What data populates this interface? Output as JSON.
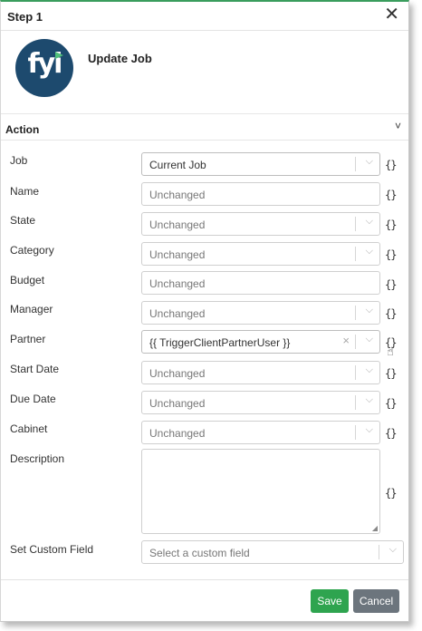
{
  "dialog": {
    "title": "Step 1",
    "close_glyph": "✕"
  },
  "app": {
    "logo_text": "fyi",
    "action_title": "Update Job"
  },
  "section": {
    "label": "Action",
    "caret": "˅"
  },
  "rows": [
    {
      "label": "Job",
      "value": "Current Job",
      "type": "select"
    },
    {
      "label": "Name",
      "placeholder": "Unchanged",
      "type": "input"
    },
    {
      "label": "State",
      "value": "Unchanged",
      "type": "select"
    },
    {
      "label": "Category",
      "value": "Unchanged",
      "type": "select"
    },
    {
      "label": "Budget",
      "placeholder": "Unchanged",
      "type": "input"
    },
    {
      "label": "Manager",
      "value": "Unchanged",
      "type": "select"
    },
    {
      "label": "Partner",
      "value": "{{ TriggerClientPartnerUser }}",
      "type": "select"
    },
    {
      "label": "Start Date",
      "value": "Unchanged",
      "type": "select"
    },
    {
      "label": "Due Date",
      "value": "Unchanged",
      "type": "select"
    },
    {
      "label": "Cabinet",
      "value": "Unchanged",
      "type": "select"
    }
  ],
  "description": {
    "label": "Description",
    "value": ""
  },
  "custom_field": {
    "label": "Set Custom Field",
    "placeholder": "Select a custom field"
  },
  "icons": {
    "variable": "{}",
    "chevron": "⌵",
    "clear": "×",
    "hand": "☝"
  },
  "footer": {
    "save_label": "Save",
    "cancel_label": "Cancel"
  },
  "colors": {
    "accent_top": "#3a9d5d",
    "logo_bg": "#1d4a6e",
    "save": "#2ea44f",
    "cancel": "#6c757d"
  }
}
